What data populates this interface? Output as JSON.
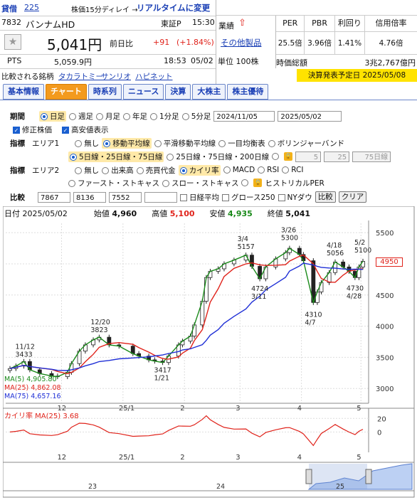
{
  "header": {
    "badge": "貸借",
    "badge_num": "225",
    "delay_note": "株価15分ディレイ →",
    "realtime_link": "リアルタイムに変更"
  },
  "stock": {
    "code": "7832",
    "name": "バンナムHD",
    "market": "東証P",
    "time": "15:30",
    "price": "5,041円",
    "prev_label": "前日比",
    "change": "+91",
    "change_pct": "(+1.84%)",
    "pts_label": "PTS",
    "pts_price": "5,059.9円",
    "pts_time": "18:53",
    "pts_date": "05/02",
    "industry_label": "業績",
    "industry_link": "その他製品",
    "unit": "単位 100株"
  },
  "metrics": {
    "headers": [
      "PER",
      "PBR",
      "利回り",
      "信用倍率"
    ],
    "values": [
      "25.5倍",
      "3.96倍",
      "1.41%",
      "4.76倍"
    ],
    "mcap_label": "時価総額",
    "mcap_value": "3兆2,767億円"
  },
  "compare": {
    "label": "比較される銘柄",
    "items": [
      "タカラトミー",
      "サンリオ",
      "ハピネット"
    ],
    "earnings": "決算発表予定日 2025/05/08"
  },
  "tabs": [
    "基本情報",
    "チャート",
    "時系列",
    "ニュース",
    "決算",
    "大株主",
    "株主優待"
  ],
  "options": {
    "period_label": "期間",
    "periods": [
      "日足",
      "週足",
      "月足",
      "年足",
      "1分足",
      "5分足"
    ],
    "date_from": "2024/11/05",
    "date_to": "2025/05/02",
    "adj_label": "修正株価",
    "hl_label": "高安値表示",
    "ind_label": "指標",
    "area1_label": "エリア1",
    "area1": [
      "無し",
      "移動平均線",
      "平滑移動平均線",
      "一目均衡表",
      "ボリンジャーバンド"
    ],
    "ma_sets": [
      "5日線・25日線・75日線",
      "25日線・75日線・200日線"
    ],
    "ma_inputs": [
      "5",
      "25",
      "75日線"
    ],
    "area2_label": "エリア2",
    "area2": [
      "無し",
      "出来高",
      "売買代金",
      "カイリ率",
      "MACD",
      "RSI",
      "RCI"
    ],
    "area2b": [
      "ファースト・ストキャス",
      "スロー・ストキャス",
      "ヒストリカルPER"
    ],
    "cmp_label": "比較",
    "cmp_codes": [
      "7867",
      "8136",
      "7552",
      ""
    ],
    "cmp_checks": [
      "日経平均",
      "グロース250",
      "NYダウ"
    ],
    "cmp_btn": "比較",
    "clear_btn": "クリア"
  },
  "ohlc": {
    "date_label": "日付 2025/05/02",
    "open_label": "始値",
    "open": "4,960",
    "high_label": "高値",
    "high": "5,100",
    "low_label": "安値",
    "low": "4,935",
    "close_label": "終値",
    "close": "5,041"
  },
  "chart_data": {
    "type": "candlestick",
    "ylim": [
      2900,
      5650
    ],
    "yticks": [
      "5500",
      "5000",
      "4500",
      "4000",
      "3500",
      "3000"
    ],
    "last_price_label": "4950",
    "xticks": [
      "12",
      "25/1",
      "2",
      "3",
      "4",
      "5"
    ],
    "annotations": [
      {
        "label": "11/12",
        "value": "3433"
      },
      {
        "label": "12/20",
        "value": "3823"
      },
      {
        "label": "3417",
        "value": "1/21"
      },
      {
        "label": "3/4",
        "value": "5157"
      },
      {
        "label": "4724",
        "value": "3/11"
      },
      {
        "label": "3/26",
        "value": "5300"
      },
      {
        "label": "4310",
        "value": "4/7"
      },
      {
        "label": "4/18",
        "value": "5056"
      },
      {
        "label": "5/2",
        "value": "5100"
      },
      {
        "label": "4730",
        "value": "4/28"
      }
    ],
    "ma_legend": [
      "MA(5)",
      "MA(25)",
      "MA(75)"
    ],
    "ma_values": [
      "4,905.80",
      "4,862.08",
      "4,657.16"
    ],
    "ma_colors": [
      "#1a8a1a",
      "#e0231b",
      "#1f2fd6"
    ],
    "close_path": [
      [
        "11/05",
        3320
      ],
      [
        "11/08",
        3360
      ],
      [
        "11/12",
        3433
      ],
      [
        "11/15",
        3300
      ],
      [
        "11/20",
        3240
      ],
      [
        "11/26",
        3200
      ],
      [
        "11/29",
        3190
      ],
      [
        "12/04",
        3260
      ],
      [
        "12/06",
        3400
      ],
      [
        "12/10",
        3600
      ],
      [
        "12/13",
        3700
      ],
      [
        "12/17",
        3780
      ],
      [
        "12/20",
        3823
      ],
      [
        "12/25",
        3700
      ],
      [
        "12/30",
        3680
      ],
      [
        "01/06",
        3560
      ],
      [
        "01/09",
        3520
      ],
      [
        "01/14",
        3460
      ],
      [
        "01/17",
        3440
      ],
      [
        "01/21",
        3417
      ],
      [
        "01/24",
        3520
      ],
      [
        "01/29",
        3700
      ],
      [
        "01/31",
        3760
      ],
      [
        "02/04",
        3840
      ],
      [
        "02/06",
        4020
      ],
      [
        "02/10",
        4400
      ],
      [
        "02/12",
        4780
      ],
      [
        "02/14",
        4880
      ],
      [
        "02/18",
        4920
      ],
      [
        "02/21",
        5000
      ],
      [
        "02/26",
        5060
      ],
      [
        "03/04",
        5140
      ],
      [
        "03/07",
        4960
      ],
      [
        "03/11",
        4760
      ],
      [
        "03/14",
        4950
      ],
      [
        "03/19",
        5080
      ],
      [
        "03/24",
        5180
      ],
      [
        "03/26",
        5250
      ],
      [
        "03/31",
        5150
      ],
      [
        "04/02",
        5050
      ],
      [
        "04/07",
        4380
      ],
      [
        "04/09",
        4550
      ],
      [
        "04/11",
        4700
      ],
      [
        "04/15",
        4860
      ],
      [
        "04/18",
        5030
      ],
      [
        "04/22",
        4950
      ],
      [
        "04/25",
        4880
      ],
      [
        "04/28",
        4780
      ],
      [
        "04/30",
        4950
      ],
      [
        "05/02",
        5041
      ]
    ],
    "osc_label": "カイリ率 MA(25)",
    "osc_value": "3.68",
    "osc_ylim": [
      -30,
      35
    ],
    "osc_yticks": [
      "20",
      "0"
    ],
    "nav_labels": [
      "23",
      "24",
      "25"
    ]
  }
}
